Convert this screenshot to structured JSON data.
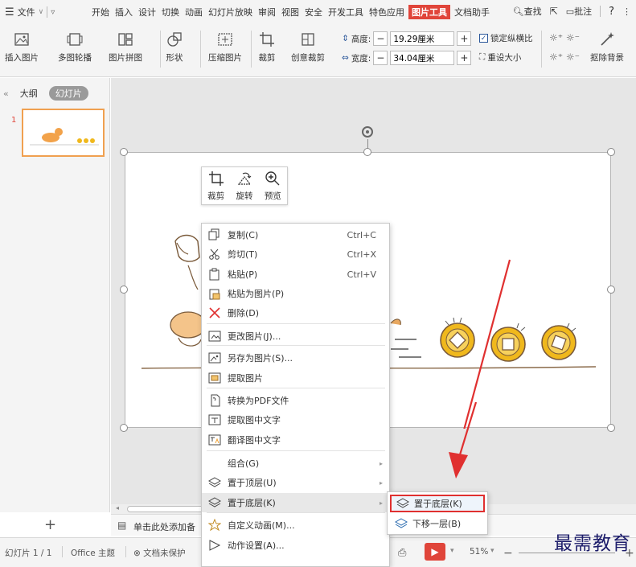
{
  "menubar": {
    "menu_icon": "hamburger-icon",
    "file_label": "文件",
    "tabs": [
      "开始",
      "插入",
      "设计",
      "切换",
      "动画",
      "幻灯片放映",
      "审阅",
      "视图",
      "安全",
      "开发工具",
      "特色应用",
      "图片工具",
      "文档助手"
    ],
    "active_tab": "图片工具",
    "search_label": "查找",
    "comment_label": "批注",
    "help_label": "?"
  },
  "ribbon": {
    "insert_picture": "插入图片",
    "multi_outline": "多图轮播",
    "picture_collage": "图片拼图",
    "shape": "形状",
    "compress": "压缩图片",
    "crop": "裁剪",
    "creative_crop": "创意裁剪",
    "height_label": "高度:",
    "height_value": "19.29厘米",
    "width_label": "宽度:",
    "width_value": "34.04厘米",
    "lock_ratio": "锁定纵横比",
    "reset_size": "重设大小",
    "remove_bg": "抠除背景",
    "minus": "−",
    "plus": "+"
  },
  "leftpanel": {
    "collapse": "«",
    "outline_tab": "大纲",
    "slides_tab": "幻灯片",
    "slide_number": "1",
    "add_slide": "+"
  },
  "mini_toolbar": {
    "crop": "裁剪",
    "rotate": "旋转",
    "preview": "预览"
  },
  "context_menu": {
    "items": [
      {
        "label": "复制(C)",
        "shortcut": "Ctrl+C",
        "icon": "copy-icon"
      },
      {
        "label": "剪切(T)",
        "shortcut": "Ctrl+X",
        "icon": "scissors-icon"
      },
      {
        "label": "粘贴(P)",
        "shortcut": "Ctrl+V",
        "icon": "paste-icon"
      },
      {
        "label": "粘贴为图片(P)",
        "shortcut": "",
        "icon": "paste-picture-icon"
      },
      {
        "label": "删除(D)",
        "shortcut": "",
        "icon": "delete-icon"
      },
      {
        "label": "更改图片(J)...",
        "shortcut": "",
        "icon": "change-picture-icon"
      },
      {
        "label": "另存为图片(S)...",
        "shortcut": "",
        "icon": "save-picture-icon"
      },
      {
        "label": "提取图片",
        "shortcut": "",
        "icon": "extract-picture-icon"
      },
      {
        "label": "转换为PDF文件",
        "shortcut": "",
        "icon": "pdf-icon"
      },
      {
        "label": "提取图中文字",
        "shortcut": "",
        "icon": "extract-text-icon"
      },
      {
        "label": "翻译图中文字",
        "shortcut": "",
        "icon": "translate-icon"
      },
      {
        "label": "组合(G)",
        "shortcut": "",
        "icon": ""
      },
      {
        "label": "置于顶层(U)",
        "shortcut": "",
        "icon": "bring-to-front-icon"
      },
      {
        "label": "置于底层(K)",
        "shortcut": "",
        "icon": "send-to-back-icon"
      },
      {
        "label": "自定义动画(M)...",
        "shortcut": "",
        "icon": "animation-icon"
      },
      {
        "label": "动作设置(A)...",
        "shortcut": "",
        "icon": "action-icon"
      }
    ]
  },
  "submenu": {
    "items": [
      {
        "label": "置于底层(K)",
        "icon": "send-to-back-icon"
      },
      {
        "label": "下移一层(B)",
        "icon": "send-backward-icon"
      }
    ]
  },
  "notes": {
    "placeholder": "单击此处添加备"
  },
  "statusbar": {
    "slide_info": "幻灯片 1 / 1",
    "theme": "Office 主题",
    "protection": "文档未保护",
    "zoom": "51%"
  },
  "watermark": "最需教育",
  "colors": {
    "accent": "#e0453a",
    "annotation_red": "#e03030",
    "coin_gold": "#f0b81c"
  }
}
